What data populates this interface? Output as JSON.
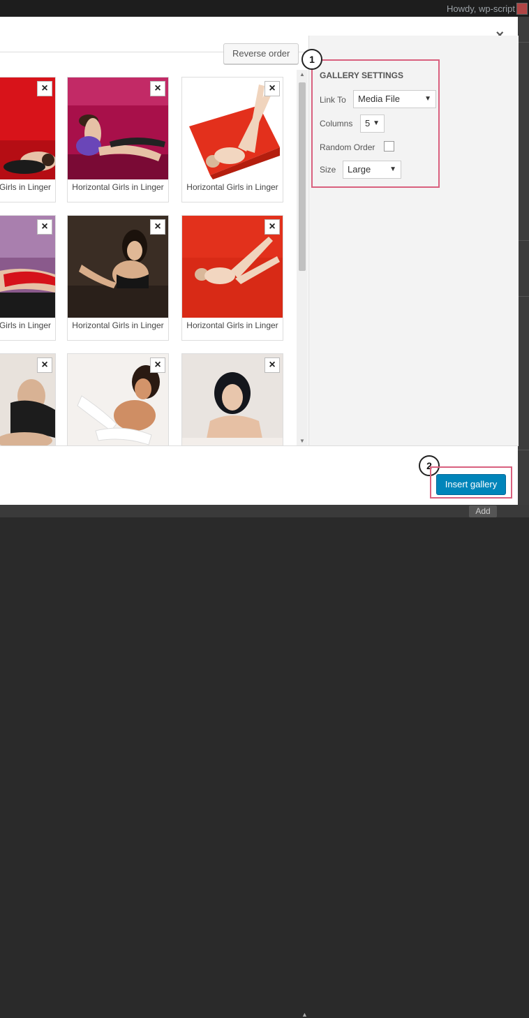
{
  "adminbar": {
    "greeting": "Howdy, wp-script"
  },
  "modal": {
    "close_label": "×"
  },
  "toolbar": {
    "reverse_order_label": "Reverse order"
  },
  "tiles": [
    {
      "caption": "Girls in Linger",
      "remove_label": "×"
    },
    {
      "caption": "Horizontal Girls in Linger",
      "remove_label": "×"
    },
    {
      "caption": "Horizontal Girls in Linger",
      "remove_label": "×"
    },
    {
      "caption": "Girls in Linger",
      "remove_label": "×"
    },
    {
      "caption": "Horizontal Girls in Linger",
      "remove_label": "×"
    },
    {
      "caption": "Horizontal Girls in Linger",
      "remove_label": "×"
    },
    {
      "caption": "",
      "remove_label": "×"
    },
    {
      "caption": "",
      "remove_label": "×"
    },
    {
      "caption": "",
      "remove_label": "×"
    }
  ],
  "gallery_settings": {
    "title": "GALLERY SETTINGS",
    "link_to_label": "Link To",
    "link_to_value": "Media File",
    "columns_label": "Columns",
    "columns_value": "5",
    "random_order_label": "Random Order",
    "random_order_checked": false,
    "size_label": "Size",
    "size_value": "Large"
  },
  "callouts": {
    "one": "1",
    "two": "2"
  },
  "footer": {
    "insert_label": "Insert gallery"
  },
  "background": {
    "add_label": "Add"
  },
  "colors": {
    "accent": "#0085ba",
    "highlight": "#d9607e"
  }
}
